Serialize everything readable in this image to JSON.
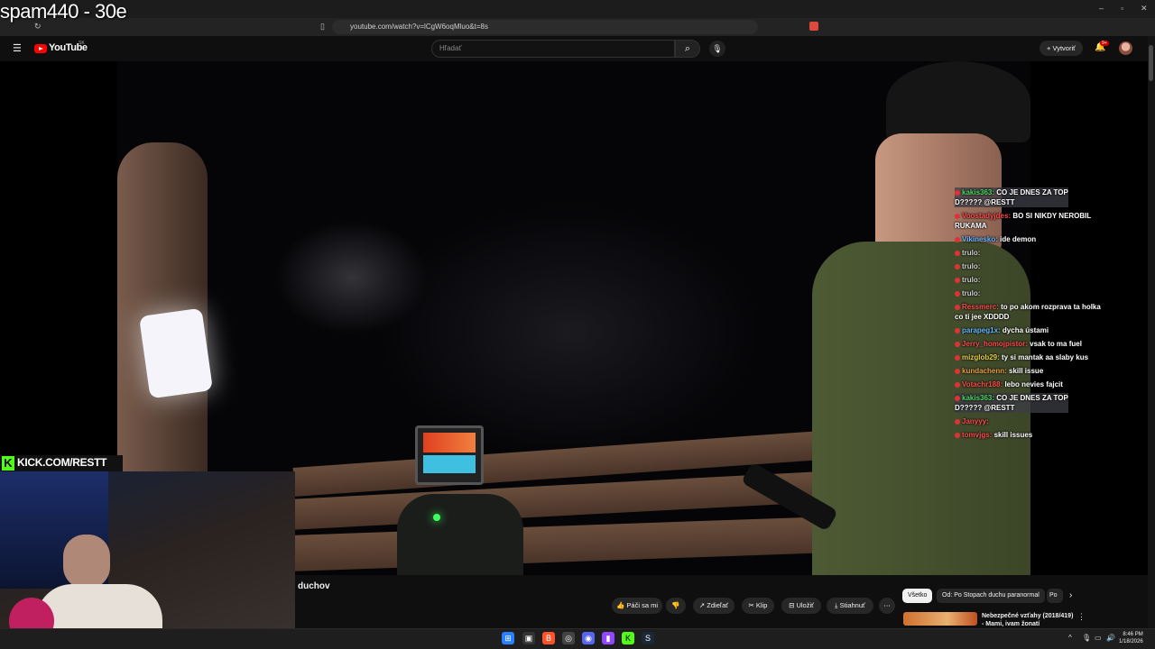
{
  "overlay": {
    "title": "spam440 - 30e"
  },
  "browser": {
    "url": "youtube.com/watch?v=lCgW6oqMluo&t=8s"
  },
  "youtube": {
    "logo": "YouTube",
    "region": "SK",
    "search_placeholder": "Hľadať",
    "create_label": "Vytvoriť",
    "notifications_badge": "9+"
  },
  "stream": {
    "kick_label": "KICK.COM/RESTT"
  },
  "chat": [
    {
      "user": "kakis363",
      "text": "CO JE DNES ZA TOP",
      "text2": "D????? @RESTT",
      "color": "#4cd964",
      "highlight": true
    },
    {
      "user": "Voostadyjdes",
      "text": "BO SI NIKDY NEROBIL",
      "text2": "RUKAMA",
      "color": "#ff4d4d"
    },
    {
      "user": "Vikinesko",
      "text": "ide demon",
      "color": "#62b6ff"
    },
    {
      "user": "trulo",
      "text": "",
      "color": "#d0d0d0"
    },
    {
      "user": "trulo",
      "text": "",
      "color": "#d0d0d0"
    },
    {
      "user": "trulo",
      "text": "",
      "color": "#d0d0d0"
    },
    {
      "user": "trulo",
      "text": "",
      "color": "#d0d0d0"
    },
    {
      "user": "Ressmerc",
      "text": "to po akom rozprava ta holka",
      "text2": "co ti jee XDDDD",
      "color": "#ff4d4d"
    },
    {
      "user": "parapeg1x",
      "text": "dycha ústami",
      "color": "#62b6ff"
    },
    {
      "user": "Jerry_homojpistor",
      "text": "vsak to ma fuel",
      "color": "#ff4d4d"
    },
    {
      "user": "mizglob29",
      "text": "ty si mantak aa slaby kus",
      "color": "#e8d040"
    },
    {
      "user": "kundachenn",
      "text": "skill issue",
      "color": "#e8a040"
    },
    {
      "user": "Votachr188",
      "text": "lebo nevies fajcit",
      "color": "#ff4d4d"
    },
    {
      "user": "kakis363",
      "text": "CO JE DNES ZA TOP",
      "text2": "D????? @RESTT",
      "color": "#4cd964",
      "highlight": true
    },
    {
      "user": "Janyyy",
      "text": "",
      "color": "#ff4d4d"
    },
    {
      "user": "tomvjgs",
      "text": "skill issues",
      "color": "#ff4d4d"
    }
  ],
  "video": {
    "title_fragment": "duchov"
  },
  "actions": {
    "like": "Páči sa mi",
    "share": "Zdieľať",
    "clip": "Klip",
    "save": "Uložiť",
    "download": "Stiahnuť"
  },
  "chips": [
    {
      "label": "Všetko",
      "active": true
    },
    {
      "label": "Od: Po Stopach duchu paranormal",
      "active": false
    },
    {
      "label": "Po",
      "active": false
    }
  ],
  "recommended": {
    "title": "Nebezpečné vzťahy (2018/419)",
    "subtitle": "- Mami, ivam žonatí"
  },
  "taskbar": {
    "time": "8:46 PM",
    "date": "1/18/2026"
  }
}
